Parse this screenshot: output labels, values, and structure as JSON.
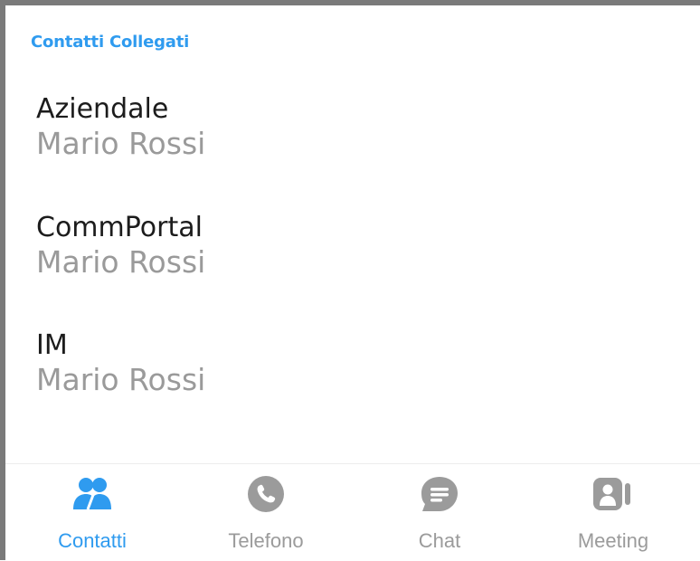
{
  "section": {
    "title": "Contatti Collegati"
  },
  "entries": [
    {
      "type": "Aziendale",
      "name": "Mario Rossi"
    },
    {
      "type": "CommPortal",
      "name": "Mario Rossi"
    },
    {
      "type": "IM",
      "name": "Mario Rossi"
    }
  ],
  "tabs": [
    {
      "label": "Contatti",
      "icon": "contacts-icon",
      "active": true
    },
    {
      "label": "Telefono",
      "icon": "phone-icon",
      "active": false
    },
    {
      "label": "Chat",
      "icon": "chat-icon",
      "active": false
    },
    {
      "label": "Meeting",
      "icon": "meeting-icon",
      "active": false
    }
  ],
  "colors": {
    "accent": "#2f9bef",
    "inactive": "#9b9b9b",
    "text_primary": "#1c1c1c",
    "text_secondary": "#9a9a9a"
  }
}
